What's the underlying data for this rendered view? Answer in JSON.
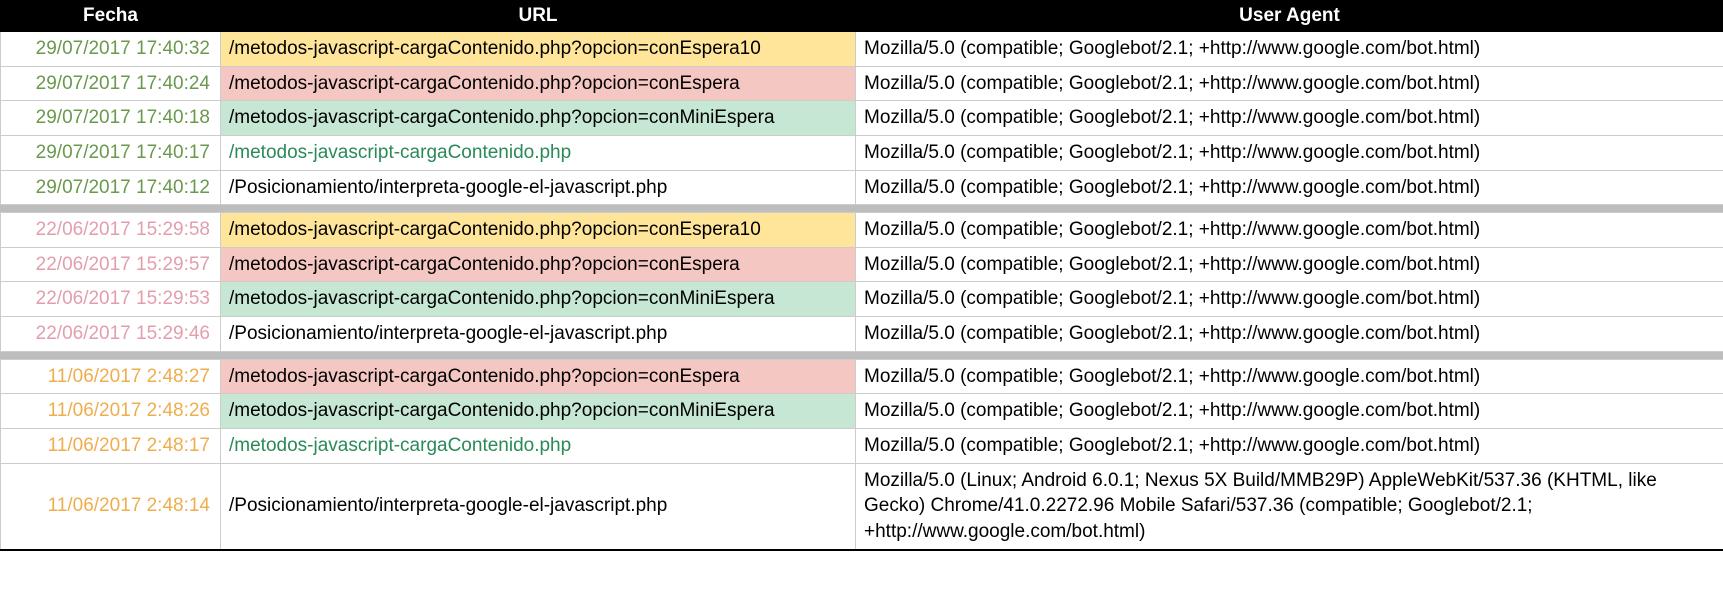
{
  "headers": {
    "fecha": "Fecha",
    "url": "URL",
    "ua": "User Agent"
  },
  "ua_googlebot": "Mozilla/5.0 (compatible; Googlebot/2.1; +http://www.google.com/bot.html)",
  "ua_googlebot_mobile": "Mozilla/5.0 (Linux; Android 6.0.1; Nexus 5X Build/MMB29P) AppleWebKit/537.36 (KHTML, like Gecko) Chrome/41.0.2272.96 Mobile Safari/537.36 (compatible; Googlebot/2.1; +http://www.google.com/bot.html)",
  "groups": [
    {
      "rows": [
        {
          "fecha": "29/07/2017 17:40:32",
          "fecha_color": "date-green",
          "url": "/metodos-javascript-cargaContenido.php?opcion=conEspera10",
          "url_bg": "bg-yellow",
          "url_text": "",
          "ua_key": "ua_googlebot"
        },
        {
          "fecha": "29/07/2017 17:40:24",
          "fecha_color": "date-green",
          "url": "/metodos-javascript-cargaContenido.php?opcion=conEspera",
          "url_bg": "bg-red",
          "url_text": "",
          "ua_key": "ua_googlebot"
        },
        {
          "fecha": "29/07/2017 17:40:18",
          "fecha_color": "date-green",
          "url": "/metodos-javascript-cargaContenido.php?opcion=conMiniEspera",
          "url_bg": "bg-green",
          "url_text": "",
          "ua_key": "ua_googlebot"
        },
        {
          "fecha": "29/07/2017 17:40:17",
          "fecha_color": "date-green",
          "url": "/metodos-javascript-cargaContenido.php",
          "url_bg": "",
          "url_text": "url-green",
          "ua_key": "ua_googlebot"
        },
        {
          "fecha": "29/07/2017 17:40:12",
          "fecha_color": "date-green",
          "url": "/Posicionamiento/interpreta-google-el-javascript.php",
          "url_bg": "",
          "url_text": "",
          "ua_key": "ua_googlebot"
        }
      ]
    },
    {
      "rows": [
        {
          "fecha": "22/06/2017 15:29:58",
          "fecha_color": "date-pink",
          "url": "/metodos-javascript-cargaContenido.php?opcion=conEspera10",
          "url_bg": "bg-yellow",
          "url_text": "",
          "ua_key": "ua_googlebot"
        },
        {
          "fecha": "22/06/2017 15:29:57",
          "fecha_color": "date-pink",
          "url": "/metodos-javascript-cargaContenido.php?opcion=conEspera",
          "url_bg": "bg-red",
          "url_text": "",
          "ua_key": "ua_googlebot"
        },
        {
          "fecha": "22/06/2017 15:29:53",
          "fecha_color": "date-pink",
          "url": "/metodos-javascript-cargaContenido.php?opcion=conMiniEspera",
          "url_bg": "bg-green",
          "url_text": "",
          "ua_key": "ua_googlebot"
        },
        {
          "fecha": "22/06/2017 15:29:46",
          "fecha_color": "date-pink",
          "url": "/Posicionamiento/interpreta-google-el-javascript.php",
          "url_bg": "",
          "url_text": "",
          "ua_key": "ua_googlebot"
        }
      ]
    },
    {
      "rows": [
        {
          "fecha": "11/06/2017 2:48:27",
          "fecha_color": "date-orange",
          "url": "/metodos-javascript-cargaContenido.php?opcion=conEspera",
          "url_bg": "bg-red",
          "url_text": "",
          "ua_key": "ua_googlebot"
        },
        {
          "fecha": "11/06/2017 2:48:26",
          "fecha_color": "date-orange",
          "url": "/metodos-javascript-cargaContenido.php?opcion=conMiniEspera",
          "url_bg": "bg-green",
          "url_text": "",
          "ua_key": "ua_googlebot"
        },
        {
          "fecha": "11/06/2017 2:48:17",
          "fecha_color": "date-orange",
          "url": "/metodos-javascript-cargaContenido.php",
          "url_bg": "",
          "url_text": "url-green",
          "ua_key": "ua_googlebot"
        },
        {
          "fecha": "11/06/2017 2:48:14",
          "fecha_color": "date-orange",
          "url": "/Posicionamiento/interpreta-google-el-javascript.php",
          "url_bg": "",
          "url_text": "",
          "ua_key": "ua_googlebot_mobile"
        }
      ]
    }
  ]
}
